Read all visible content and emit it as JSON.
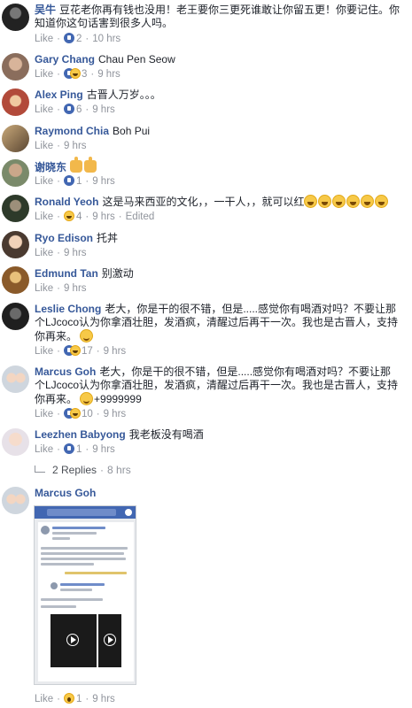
{
  "labels": {
    "like": "Like",
    "edited": "Edited"
  },
  "comments": [
    {
      "name": "吴牛",
      "text": "豆花老你再有钱也没用！老王要你三更死谁敢让你留五更！你要记住。你知道你这句话害到很多人吗。",
      "reaction_count": "2",
      "time": "10 hrs"
    },
    {
      "name": "Gary Chang",
      "text": "Chau Pen Seow",
      "reaction_count": "3",
      "time": "9 hrs"
    },
    {
      "name": "Alex Ping",
      "text": "古晋人万岁。。。",
      "reaction_count": "6",
      "time": "9 hrs"
    },
    {
      "name": "Raymond Chia",
      "text": "Boh Pui",
      "reaction_count": "",
      "time": "9 hrs"
    },
    {
      "name": "谢晓东",
      "text": "",
      "reaction_count": "1",
      "time": "9 hrs"
    },
    {
      "name": "Ronald Yeoh",
      "text": "这是马来西亚的文化，，一干人，，就可以红",
      "reaction_count": "4",
      "time": "9 hrs"
    },
    {
      "name": "Ryo Edison",
      "text": "托丼",
      "reaction_count": "",
      "time": "9 hrs"
    },
    {
      "name": "Edmund Tan",
      "text": "别激动",
      "reaction_count": "",
      "time": "9 hrs"
    },
    {
      "name": "Leslie Chong",
      "text": "老大，你是干的很不错，但是.....感觉你有喝酒对吗？不要让那个LJcoco认为你拿酒壮胆，发酒疯，清醒过后再干一次。我也是古晋人，支持你再来。",
      "reaction_count": "17",
      "time": "9 hrs"
    },
    {
      "name": "Marcus Goh",
      "text": "老大，你是干的很不错，但是.....感觉你有喝酒对吗？不要让那个LJcoco认为你拿酒壮胆，发酒疯，清醒过后再干一次。我也是古晋人，支持你再来。",
      "text_suffix": "+9999999",
      "reaction_count": "10",
      "time": "9 hrs"
    },
    {
      "name": "Leezhen Babyong",
      "text": "我老板没有喝酒",
      "reaction_count": "1",
      "time": "9 hrs"
    },
    {
      "name": "Marcus Goh",
      "text": "",
      "reaction_count": "1",
      "time": "9 hrs"
    }
  ],
  "replies": {
    "count_label": "2 Replies",
    "time": "8 hrs"
  },
  "colors": {
    "name": "#365899",
    "meta": "#90949c",
    "like_blue": "#4267b2"
  }
}
